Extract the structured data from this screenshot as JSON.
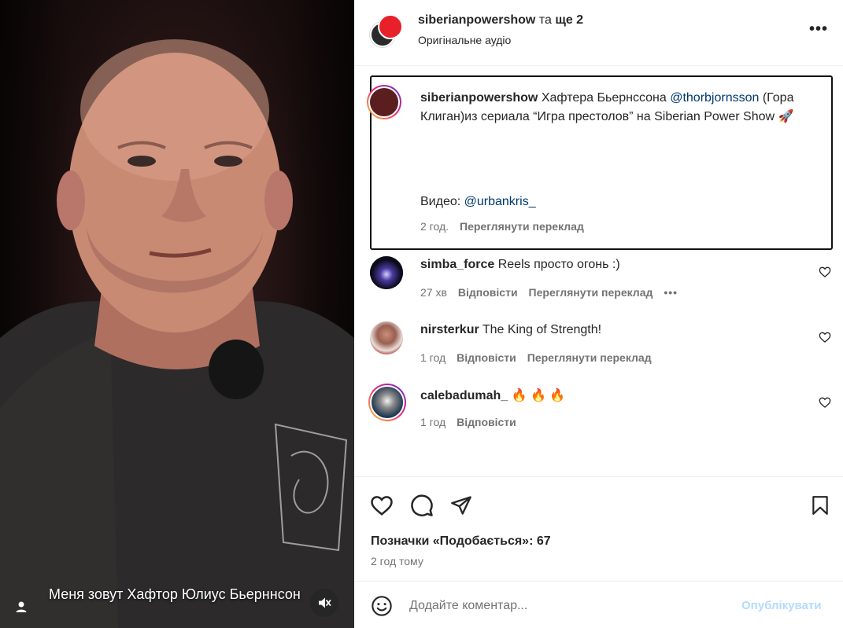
{
  "video": {
    "subtitle": "Меня зовут Хафтор Юлиус Бьерннсон",
    "user_tag_icon": "person-icon",
    "mute_icon": "speaker-muted-icon"
  },
  "header": {
    "username": "siberianpowershow",
    "and_text": " та ",
    "more_count": "ще 2",
    "audio_label": "Оригінальне аудіо",
    "more_icon": "•••"
  },
  "caption": {
    "username": "siberianpowershow",
    "text_before": " Хафтера Бьернссона ",
    "mention": "@thorbjornsson",
    "text_after": " (Гора Клиган)из сериала “Игра престолов” на Siberian Power Show 🚀",
    "video_label": "Видео: ",
    "video_mention": "@urbankris_",
    "time": "2 год.",
    "translate": "Переглянути переклад"
  },
  "comments": [
    {
      "username": "simba_force",
      "text": " Reels просто огонь :)",
      "time": "27 хв",
      "reply": "Відповісти",
      "translate": "Переглянути переклад",
      "more": "•••"
    },
    {
      "username": "nirsterkur",
      "text": " The King of Strength!",
      "time": "1 год",
      "reply": "Відповісти",
      "translate": "Переглянути переклад"
    },
    {
      "username": "calebadumah_",
      "text": " 🔥 🔥 🔥",
      "time": "1 год",
      "reply": "Відповісти"
    }
  ],
  "actions": {
    "likes": "Позначки «Подобається»: 67",
    "time_ago": "2 год тому"
  },
  "composer": {
    "placeholder": "Додайте коментар...",
    "post_label": "Опублікувати"
  },
  "colors": {
    "link": "#00376b",
    "muted": "#737373",
    "post_disabled": "#b3dbff"
  }
}
